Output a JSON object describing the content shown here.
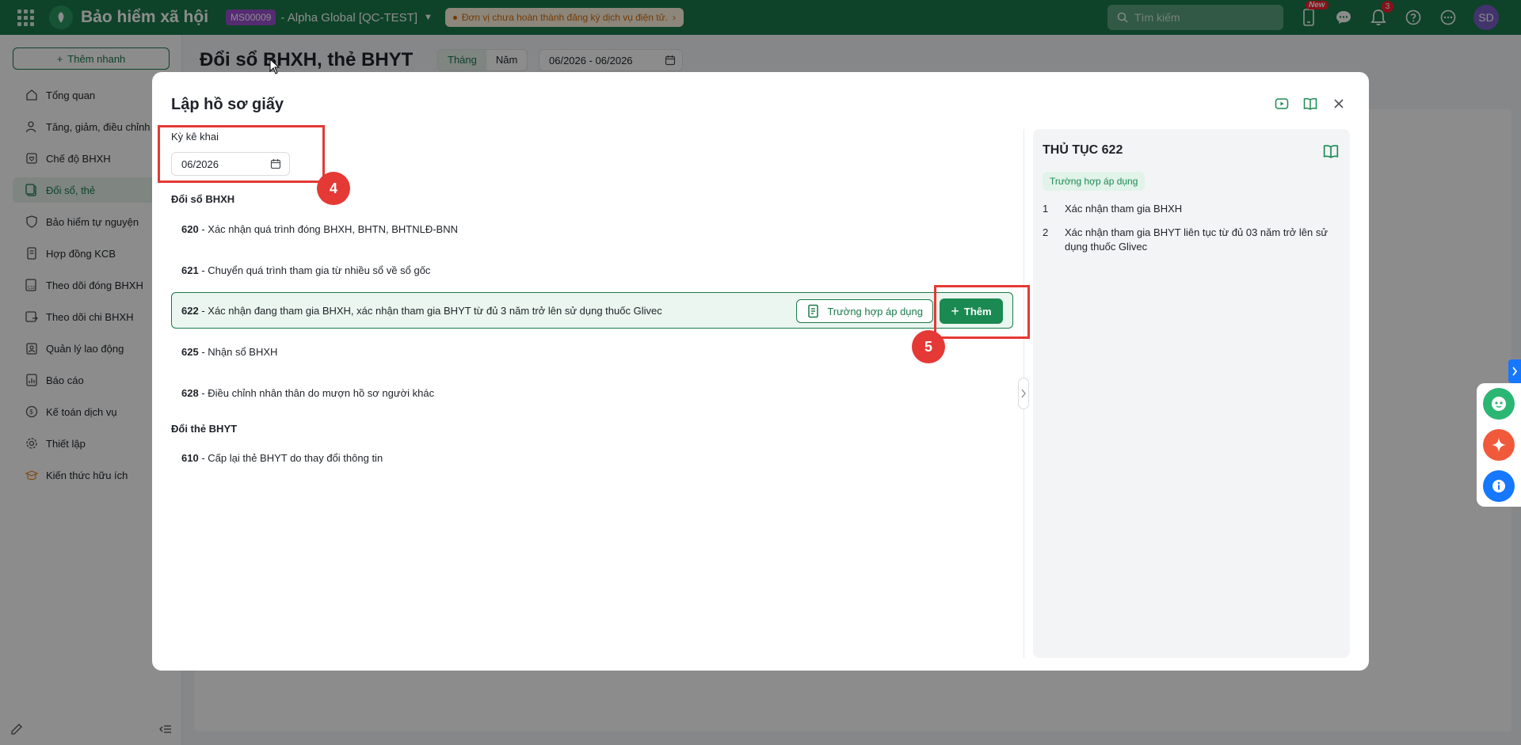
{
  "topbar": {
    "app_title": "Bảo hiểm xã hội",
    "tenant_code": "MS00009",
    "tenant_name": "- Alpha Global [QC-TEST]",
    "warning": "Đơn vị chưa hoàn thành đăng ký dịch vụ điện tử.",
    "search_placeholder": "Tìm kiếm",
    "new_tag": "New",
    "notification_count": "3",
    "avatar_initials": "SD",
    "brand_color": "#1b7a4b"
  },
  "sidebar": {
    "quick_add": "Thêm nhanh",
    "items": [
      {
        "label": "Tổng quan",
        "icon": "home-icon"
      },
      {
        "label": "Tăng, giảm, điều chỉnh",
        "icon": "user-adjust-icon"
      },
      {
        "label": "Chế độ BHXH",
        "icon": "heart-icon"
      },
      {
        "label": "Đổi sổ, thẻ",
        "icon": "card-swap-icon",
        "active": true
      },
      {
        "label": "Bảo hiểm tự nguyện",
        "icon": "shield-icon"
      },
      {
        "label": "Hợp đồng KCB",
        "icon": "contract-icon"
      },
      {
        "label": "Theo dõi đóng BHXH",
        "icon": "c12-icon"
      },
      {
        "label": "Theo dõi chi BHXH",
        "icon": "payment-icon"
      },
      {
        "label": "Quản lý lao động",
        "icon": "clipboard-user-icon"
      },
      {
        "label": "Báo cáo",
        "icon": "report-icon"
      },
      {
        "label": "Kế toán dịch vụ",
        "icon": "accounting-icon"
      },
      {
        "label": "Thiết lập",
        "icon": "gear-icon"
      },
      {
        "label": "Kiến thức hữu ích",
        "icon": "knowledge-icon"
      }
    ]
  },
  "page": {
    "title": "Đổi sổ BHXH, thẻ BHYT",
    "seg_month": "Tháng",
    "seg_year": "Năm",
    "period": "06/2026 - 06/2026"
  },
  "modal": {
    "title": "Lập hồ sơ giấy",
    "period_label": "Kỳ kê khai",
    "period_value": "06/2026",
    "group1_title": "Đổi sổ BHXH",
    "group1": [
      {
        "code": "620",
        "text": "- Xác nhận quá trình đóng BHXH, BHTN, BHTNLĐ-BNN"
      },
      {
        "code": "621",
        "text": "- Chuyển quá trình tham gia từ nhiều sổ về sổ gốc"
      },
      {
        "code": "622",
        "text": "- Xác nhận đang tham gia BHXH, xác nhận tham gia BHYT từ đủ 3 năm trở lên sử dụng thuốc Glivec"
      },
      {
        "code": "625",
        "text": "- Nhận sổ BHXH"
      },
      {
        "code": "628",
        "text": "- Điều chỉnh nhân thân do mượn hồ sơ người khác"
      }
    ],
    "group2_title": "Đổi thẻ BHYT",
    "group2": [
      {
        "code": "610",
        "text": "- Cấp lại thẻ BHYT do thay đổi thông tin"
      }
    ],
    "case_button": "Trường hợp áp dụng",
    "add_button": "Thêm"
  },
  "panel": {
    "title": "THỦ TỤC 622",
    "tag": "Trường hợp áp dụng",
    "items": [
      {
        "n": "1",
        "text": "Xác nhận tham gia BHXH"
      },
      {
        "n": "2",
        "text": "Xác nhận tham gia BHYT liên tục từ đủ 03 năm trở lên sử dụng thuốc Glivec"
      }
    ]
  },
  "annotations": {
    "step4": "4",
    "step5": "5",
    "highlight_color": "#e53935"
  }
}
